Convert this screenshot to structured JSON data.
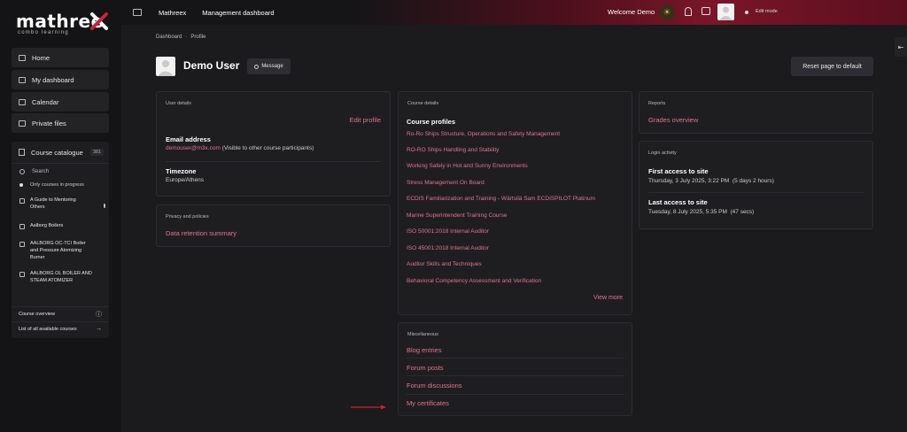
{
  "brand": {
    "name": "mathree",
    "tagline": "combo learning"
  },
  "sidebar": {
    "items": [
      {
        "label": "Home"
      },
      {
        "label": "My dashboard"
      },
      {
        "label": "Calendar"
      },
      {
        "label": "Private files"
      }
    ],
    "catalogue": {
      "title": "Course catalogue",
      "count": "381",
      "search_placeholder": "Search",
      "filter": "Only courses in progress",
      "courses": [
        {
          "line1": "A Guide to Mentoring",
          "line2": "Others"
        },
        {
          "line1": "Aalborg Boilers",
          "line2": ""
        },
        {
          "line1": "AALBORG OC-TCI Boiler",
          "line2": "and Pressure Atomizing",
          "line3": "Burner"
        },
        {
          "line1": "AALBORG OL BOILER AND",
          "line2": "STEAM ATOMIZER"
        }
      ],
      "overview": "Course overview",
      "all_courses": "List of all available courses"
    }
  },
  "topbar": {
    "links": [
      "Mathreex",
      "Management dashboard"
    ],
    "welcome": "Welcome Demo",
    "edit_mode": "Edit mode"
  },
  "breadcrumb": [
    "Dashboard",
    "Profile"
  ],
  "profile": {
    "name": "Demo User",
    "message_button": "Message",
    "reset_button": "Reset page to default"
  },
  "user_details": {
    "title": "User details",
    "edit_link": "Edit profile",
    "email_label": "Email address",
    "email_value": "demouser@m3x.com",
    "email_note": "(Visible to other course participants)",
    "timezone_label": "Timezone",
    "timezone_value": "Europe/Athens"
  },
  "privacy": {
    "title": "Privacy and policies",
    "link": "Data retention summary"
  },
  "course_details": {
    "title": "Course details",
    "subtitle": "Course profiles",
    "courses": [
      "Ro-Ro Ships Structure, Operations and Safety Management",
      "RO-RO Ships Handling and Stability",
      "Working Safely in Hot and Sunny Environments",
      "Stress Management On Board",
      "ECDIS Familiarization and Training - Wärtsilä Sam ECDISPILOT Platinum",
      "Marine Superintendent Training Course",
      "ISO 50001:2018 Internal Auditor",
      "ISO 45001:2018 Internal Auditor",
      "Auditor Skills and Techniques",
      "Behavioral Competency Assessment and Verification"
    ],
    "view_more": "View more"
  },
  "miscellaneous": {
    "title": "Miscellaneous",
    "links": [
      "Blog entries",
      "Forum posts",
      "Forum discussions",
      "My certificates"
    ]
  },
  "reports": {
    "title": "Reports",
    "link": "Grades overview"
  },
  "login_activity": {
    "title": "Login activity",
    "first_label": "First access to site",
    "first_value": "Thursday, 3 July 2025, 3:22 PM  (5 days 2 hours)",
    "last_label": "Last access to site",
    "last_value": "Tuesday, 8 July 2025, 5:35 PM  (47 secs)"
  },
  "colors": {
    "accent": "#e3748c",
    "annotation_arrow": "#d0202a"
  }
}
